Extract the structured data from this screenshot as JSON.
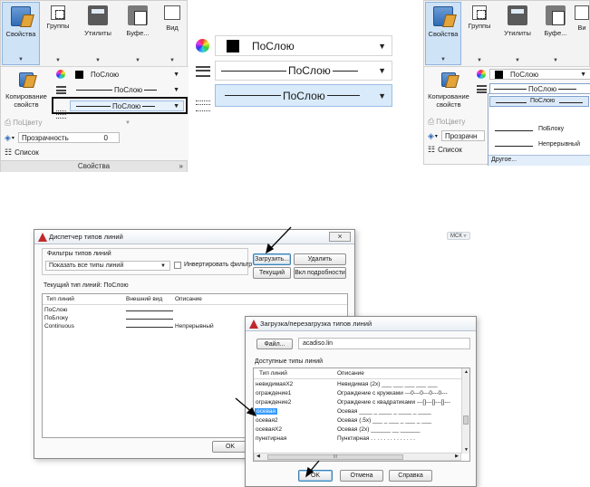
{
  "ribbon_left": {
    "buttons": [
      {
        "label": "Свойства",
        "icon": "properties-icon"
      },
      {
        "label": "Группы",
        "icon": "groups-icon"
      },
      {
        "label": "Утилиты",
        "icon": "calculator-icon"
      },
      {
        "label": "Буфе...",
        "icon": "clipboard-icon"
      },
      {
        "label": "Вид",
        "icon": "view-icon"
      }
    ],
    "match_label_line1": "Копирование",
    "match_label_line2": "свойств",
    "color_value": "ПоСлою",
    "linetype_value": "ПоСлою",
    "lineweight_value": "ПоСлою",
    "plotstyle_value": "ПоЦвету",
    "transparency_label": "Прозрачность",
    "transparency_value": "0",
    "list_label": "Список",
    "footer": "Свойства",
    "footer_arrow": "»"
  },
  "zoom": {
    "color_value": "ПоСлою",
    "linetype_value": "ПоСлою",
    "lineweight_value": "ПоСлою"
  },
  "ribbon_right": {
    "buttons": [
      {
        "label": "Свойства"
      },
      {
        "label": "Группы"
      },
      {
        "label": "Утилиты"
      },
      {
        "label": "Буфе..."
      },
      {
        "label": "Ви"
      }
    ],
    "match_label_line1": "Копирование",
    "match_label_line2": "свойств",
    "color_value": "ПоСлою",
    "linetype_value": "ПоСлою",
    "plotstyle_value": "ПоЦвету",
    "transparency_label": "Прозрачн",
    "list_label": "Список",
    "dropdown_items": [
      "ПоСлою",
      "ПоБлоку",
      "Непрерывный",
      "Другое..."
    ]
  },
  "ltm_dialog": {
    "title": "Диспетчер типов линий",
    "close": "⨯",
    "filters_label": "Фильтры типов линий",
    "filter_value": "Показать все типы линий",
    "invert_label": "Инвертировать фильтр",
    "load_button": "Загрузить...",
    "delete_button": "Удалить",
    "current_button": "Текущий",
    "details_button": "Вкл подробности",
    "current_linetype": "Текущий тип линий:  ПоСлою",
    "columns": [
      "Тип линий",
      "Внешний вид",
      "Описание"
    ],
    "rows": [
      {
        "name": "ПоСлою",
        "desc": ""
      },
      {
        "name": "ПоБлоку",
        "desc": ""
      },
      {
        "name": "Continuous",
        "desc": "Непрерывный"
      }
    ],
    "ok_button": "OK"
  },
  "load_dialog": {
    "title": "Загрузка/перезагрузка типов линий",
    "file_button": "Файл...",
    "file_value": "acadiso.lin",
    "available_label": "Доступные типы линий",
    "columns": [
      "Тип линий",
      "Описание"
    ],
    "rows": [
      {
        "name": "невидимаяX2",
        "desc": "Невидимая (2x) ___ ___ ___ ___ ___",
        "pattern": "dash"
      },
      {
        "name": "ограждение1",
        "desc": "Ограждение с кружками ---0---0---0---0---",
        "pattern": "solid"
      },
      {
        "name": "ограждение2",
        "desc": "Ограждение с квадратиками ---[]---[]---[]---",
        "pattern": "solid"
      },
      {
        "name": "осевая",
        "desc": "Осевая ____ _ ____ _ ____ _ ____",
        "pattern": "dash",
        "selected": true
      },
      {
        "name": "осевая2",
        "desc": "Осевая (.5x) ___ _ ___ _ ___ _ ___",
        "pattern": "dash"
      },
      {
        "name": "осеваяX2",
        "desc": "Осевая (2x) ______ __ ______",
        "pattern": "dash"
      },
      {
        "name": "пунктирная",
        "desc": "Пунктирная . . . . . . . . . . . . . .",
        "pattern": "dot"
      }
    ],
    "scroll_label": "III",
    "ok_button": "OK",
    "cancel_button": "Отмена",
    "help_button": "Справка"
  },
  "msk_label": "МСК ▿"
}
